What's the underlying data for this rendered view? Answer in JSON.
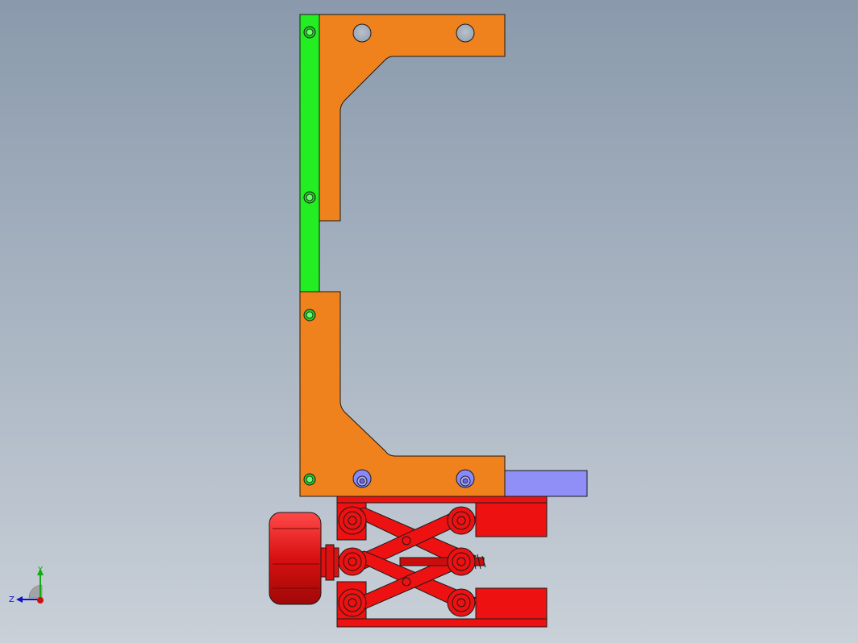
{
  "viewport": {
    "background_top": "#8a9aac",
    "background_bottom": "#c9d0d8"
  },
  "colors": {
    "bracket": "#f0821e",
    "rail": "#22ee22",
    "spacer_block": "#8f8ff7",
    "lift_stage": "#ee1111",
    "knob": "#e01010",
    "edge": "#1a1a1a",
    "hole": "#a9b3bf",
    "screw_green": "#22cc22",
    "screw_blue": "#8888ff"
  },
  "triad": {
    "x_axis_color": "#cc1111",
    "y_axis_color": "#11aa11",
    "z_axis_color": "#1111cc",
    "y_label": "Y",
    "z_label": "Z"
  },
  "icons": {
    "view_triad": "view-orientation-triad-icon"
  }
}
